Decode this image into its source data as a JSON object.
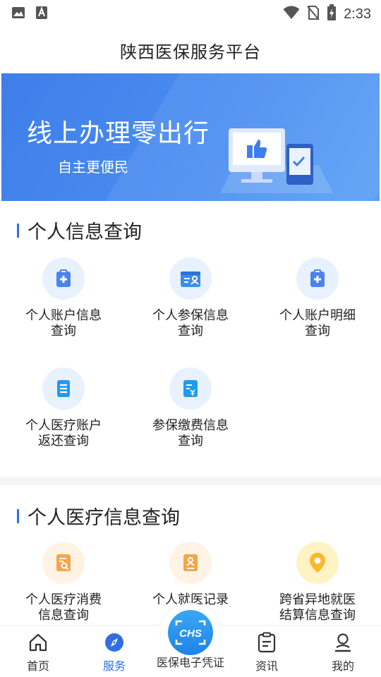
{
  "status_bar": {
    "time": "2:33",
    "icons": [
      "image-icon",
      "a-icon",
      "wifi-icon",
      "no-sim-icon",
      "battery-charging-icon"
    ]
  },
  "header": {
    "title": "陕西医保服务平台"
  },
  "banner": {
    "title": "线上办理零出行",
    "subtitle": "自主更便民"
  },
  "section1": {
    "title": "个人信息查询",
    "items": [
      {
        "line1": "个人账户信息",
        "line2": "查询",
        "icon": "medical-clipboard-icon"
      },
      {
        "line1": "个人参保信息",
        "line2": "查询",
        "icon": "id-card-icon"
      },
      {
        "line1": "个人账户明细",
        "line2": "查询",
        "icon": "medical-clipboard-icon"
      },
      {
        "line1": "个人医疗账户",
        "line2": "返还查询",
        "icon": "document-list-icon"
      },
      {
        "line1": "参保缴费信息",
        "line2": "查询",
        "icon": "payment-document-icon"
      }
    ]
  },
  "section2": {
    "title": "个人医疗信息查询",
    "items": [
      {
        "line1": "个人医疗消费",
        "line2": "信息查询",
        "icon": "search-document-icon"
      },
      {
        "line1": "个人就医记录",
        "line2": "",
        "icon": "medical-record-icon"
      },
      {
        "line1": "跨省异地就医",
        "line2": "结算信息查询",
        "icon": "location-pin-icon"
      }
    ]
  },
  "tabbar": {
    "tabs": [
      {
        "label": "首页",
        "icon": "home-icon"
      },
      {
        "label": "服务",
        "icon": "compass-icon"
      },
      {
        "label": "医保电子凭证",
        "icon": "chs-scan-icon",
        "badge_text": "CHS"
      },
      {
        "label": "资讯",
        "icon": "clipboard-icon"
      },
      {
        "label": "我的",
        "icon": "user-icon"
      }
    ],
    "active": "服务"
  },
  "colors": {
    "accent": "#2f6fe3",
    "banner": "#4a8df1",
    "orange": "#f5a54a",
    "yellow": "#f7c531"
  }
}
